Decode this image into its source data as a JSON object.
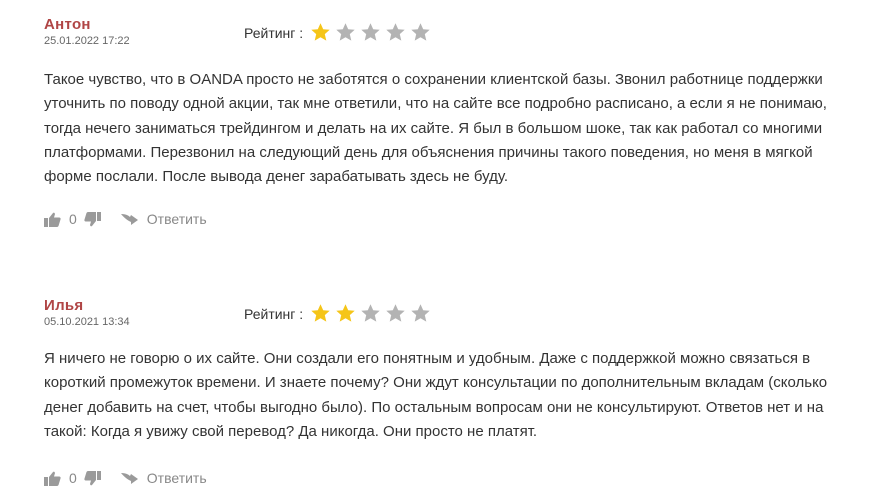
{
  "reviews": [
    {
      "author": "Антон",
      "date": "25.01.2022 17:22",
      "rating_label": "Рейтинг :",
      "rating": 1,
      "max_rating": 5,
      "text": "Такое чувство, что в OANDA просто не заботятся о сохранении клиентской базы. Звонил работнице поддержки уточнить по поводу одной акции, так мне ответили, что на сайте все подробно расписано, а если я не понимаю, тогда нечего заниматься трейдингом и делать на их сайте. Я был в большом шоке, так как работал со многими платформами. Перезвонил на следующий день для объяснения причины такого поведения, но меня в мягкой форме послали. После вывода денег зарабатывать здесь не буду.",
      "likes": "0",
      "reply_label": "Ответить"
    },
    {
      "author": "Илья",
      "date": "05.10.2021 13:34",
      "rating_label": "Рейтинг :",
      "rating": 2,
      "max_rating": 5,
      "text": "Я ничего не говорю о их сайте. Они создали его понятным и удобным. Даже с поддержкой можно связаться в короткий промежуток времени. И знаете почему? Они ждут консультации по дополнительным вкладам (сколько денег добавить на счет, чтобы выгодно было). По остальным вопросам они не консультируют. Ответов нет и на такой: Когда я увижу свой перевод? Да никогда. Они просто не платят.",
      "likes": "0",
      "reply_label": "Ответить"
    }
  ],
  "colors": {
    "author": "#b04545",
    "star_filled": "#f5c518",
    "star_empty": "#b3b3b3",
    "icon": "#9a9a9a"
  },
  "icons": {
    "star": "star-icon",
    "like": "thumbs-up-icon",
    "dislike": "thumbs-down-icon",
    "reply": "reply-arrow-icon"
  }
}
